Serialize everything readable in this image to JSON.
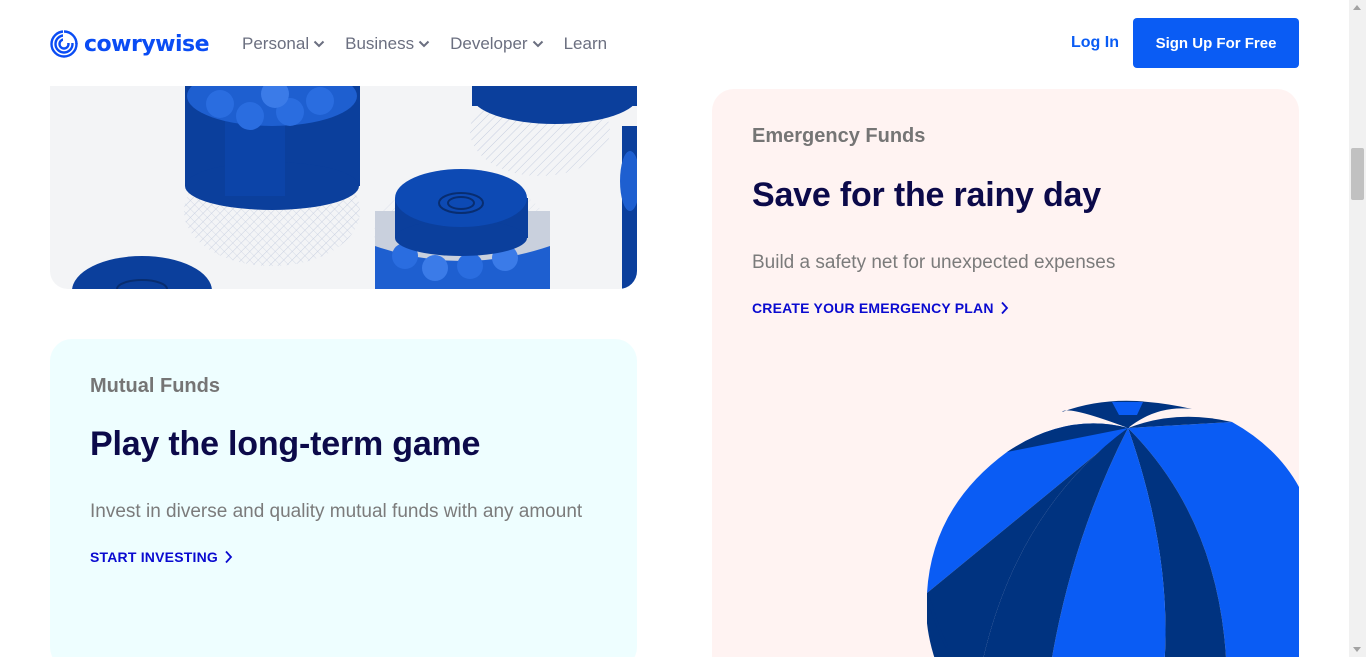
{
  "brand": {
    "name": "cowrywise",
    "color": "#0a4cf4"
  },
  "nav": [
    {
      "label": "Personal",
      "has_dropdown": true
    },
    {
      "label": "Business",
      "has_dropdown": true
    },
    {
      "label": "Developer",
      "has_dropdown": true
    },
    {
      "label": "Learn",
      "has_dropdown": false
    }
  ],
  "header": {
    "login_label": "Log In",
    "signup_label": "Sign Up For Free"
  },
  "cards": {
    "mutual": {
      "eyebrow": "Mutual Funds",
      "title": "Play the long-term game",
      "description": "Invest in diverse and quality mutual funds with any amount",
      "cta": "START INVESTING",
      "background": "#eefeff"
    },
    "emergency": {
      "eyebrow": "Emergency Funds",
      "title": "Save for the rainy day",
      "description": "Build a safety net for unexpected expenses",
      "cta": "CREATE YOUR EMERGENCY PLAN",
      "background": "#fff3f2"
    }
  },
  "icons": [
    "cowrywise-logo-icon",
    "chevron-down-icon",
    "chevron-right-icon",
    "coin-jars-illustration",
    "umbrella-illustration"
  ],
  "colors": {
    "primary": "#0a5cf4",
    "navy": "#0c0a4a",
    "cta": "#0a0ad0",
    "muted": "#757575"
  }
}
